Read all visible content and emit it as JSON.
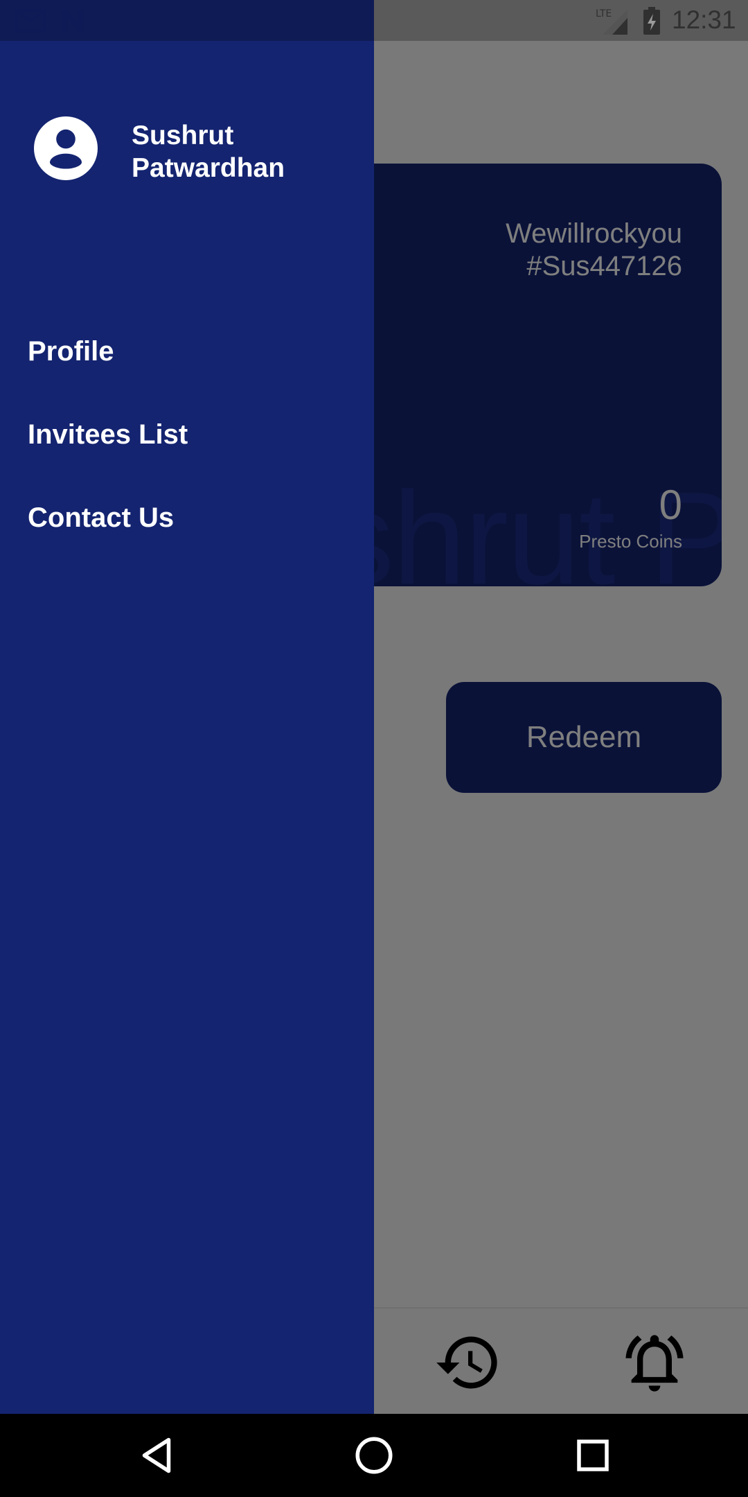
{
  "status_bar": {
    "time": "12:31",
    "icons": [
      "gmail-icon",
      "n-icon",
      "lte-signal-icon",
      "battery-charging-icon"
    ],
    "network_label": "LTE"
  },
  "drawer": {
    "user_name_line1": "Sushrut",
    "user_name_line2": "Patwardhan",
    "avatar_icon": "account-circle-icon",
    "menu_items": [
      {
        "label": "Profile"
      },
      {
        "label": "Invitees List"
      },
      {
        "label": "Contact Us"
      }
    ]
  },
  "background_app": {
    "card": {
      "username_line1": "Wewillrockyou",
      "username_line2": "#Sus447126",
      "coins": "0",
      "coins_label": "Presto Coins",
      "watermark": "shrut P"
    },
    "redeem_label": "Redeem",
    "bottom_icons": [
      "history-icon",
      "bell-icon"
    ]
  },
  "colors": {
    "primary": "#142470",
    "scrim": "rgba(0,0,0,0.5)",
    "drawer_text": "#ffffff"
  }
}
